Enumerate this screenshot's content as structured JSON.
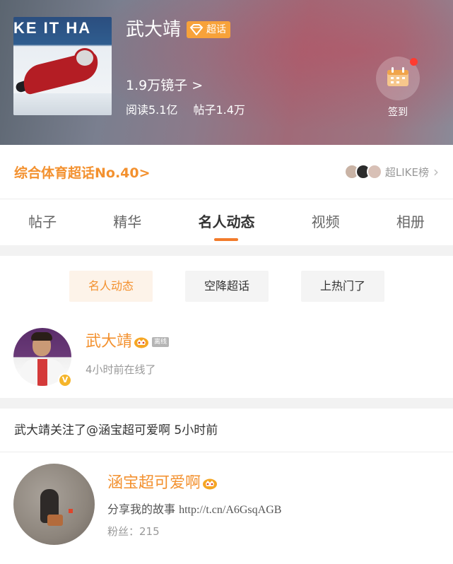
{
  "header": {
    "cover_banner_text": "KE IT HA",
    "topic_name": "武大靖",
    "badge_label": "超话",
    "mirror_text": "1.9万镜子 >",
    "reads": "阅读5.1亿",
    "posts": "帖子1.4万",
    "checkin_label": "签到"
  },
  "rank": {
    "text": "综合体育超话No.40>",
    "board_label": "超LIKE榜",
    "chevron": "›"
  },
  "tabs": [
    {
      "label": "帖子",
      "active": false
    },
    {
      "label": "精华",
      "active": false
    },
    {
      "label": "名人动态",
      "active": true
    },
    {
      "label": "视频",
      "active": false
    },
    {
      "label": "相册",
      "active": false
    }
  ],
  "chips": [
    {
      "label": "名人动态",
      "active": true
    },
    {
      "label": "空降超话",
      "active": false
    },
    {
      "label": "上热门了",
      "active": false
    }
  ],
  "celebrity": {
    "name": "武大靖",
    "offline_tag": "离线",
    "status": "4小时前在线了",
    "verify_mark": "V"
  },
  "follow": {
    "header_text": "武大靖关注了@涵宝超可爱啊 5小时前",
    "user_name": "涵宝超可爱啊",
    "bio_prefix": "分享我的故事 ",
    "bio_link": "http://t.cn/A6GsqAGB",
    "fans": "粉丝：215"
  },
  "colors": {
    "accent_orange": "#f3912f",
    "tab_indicator": "#f27b2b",
    "badge_orange": "#f7a23a",
    "notification_red": "#ff3b30"
  },
  "icons": [
    "diamond-icon",
    "calendar-icon",
    "crown-icon",
    "verify-icon",
    "chevron-right-icon"
  ]
}
